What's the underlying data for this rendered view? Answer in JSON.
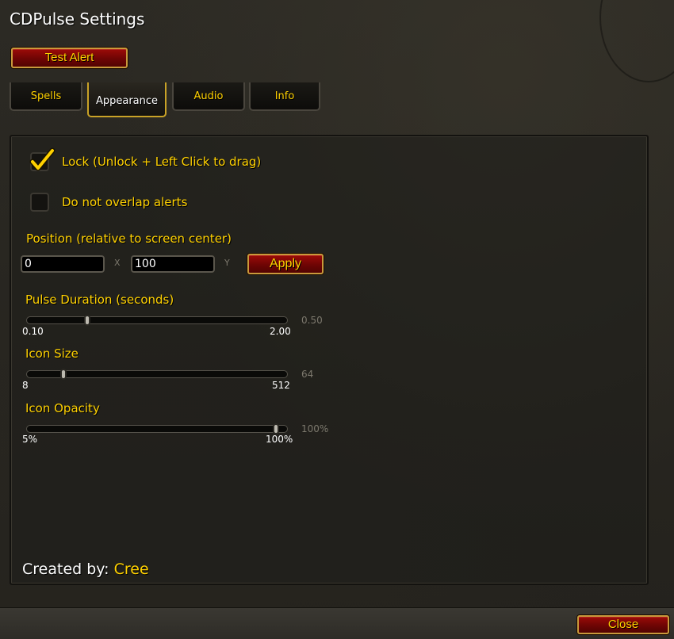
{
  "window": {
    "title": "CDPulse Settings"
  },
  "toolbar": {
    "test_alert_label": "Test Alert"
  },
  "tabs": [
    {
      "label": "Spells",
      "active": false
    },
    {
      "label": "Appearance",
      "active": true
    },
    {
      "label": "Audio",
      "active": false
    },
    {
      "label": "Info",
      "active": false
    }
  ],
  "options": {
    "lock": {
      "label": "Lock (Unlock + Left Click to drag)",
      "checked": true
    },
    "no_overlap": {
      "label": "Do not overlap alerts",
      "checked": false
    }
  },
  "position": {
    "label": "Position (relative to screen center)",
    "x_value": "0",
    "x_axis": "X",
    "y_value": "100",
    "y_axis": "Y",
    "apply_label": "Apply"
  },
  "sliders": [
    {
      "label": "Pulse Duration (seconds)",
      "min_label": "0.10",
      "max_label": "2.00",
      "value_label": "0.50",
      "min": 0.1,
      "max": 2.0,
      "value": 0.5
    },
    {
      "label": "Icon Size",
      "min_label": "8",
      "max_label": "512",
      "value_label": "64",
      "min": 8,
      "max": 512,
      "value": 64
    },
    {
      "label": "Icon Opacity",
      "min_label": "5%",
      "max_label": "100%",
      "value_label": "100%",
      "min": 5,
      "max": 100,
      "value": 100
    }
  ],
  "footer": {
    "created_by_label": "Created by:",
    "author": "Cree"
  },
  "close_label": "Close",
  "colors": {
    "accent_gold": "#ffd100",
    "button_red": "#8b0a06",
    "background": "#26241f"
  }
}
